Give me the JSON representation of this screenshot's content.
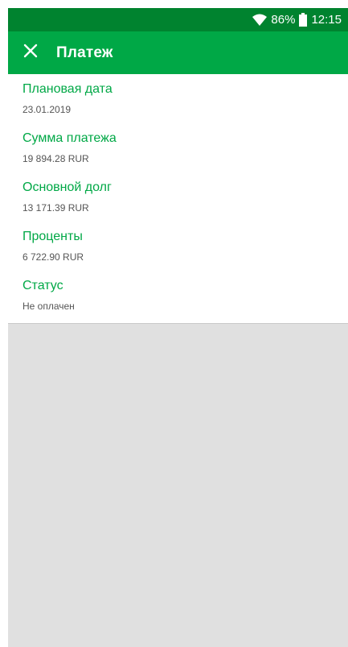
{
  "status_bar": {
    "battery": "86%",
    "time": "12:15",
    "icons": [
      "wifi-icon",
      "battery-icon"
    ]
  },
  "app_bar": {
    "title": "Платеж",
    "close_icon": "close-icon"
  },
  "details": [
    {
      "label": "Плановая дата",
      "value": "23.01.2019"
    },
    {
      "label": "Сумма платежа",
      "value": "19 894.28 RUR"
    },
    {
      "label": "Основной долг",
      "value": "13 171.39 RUR"
    },
    {
      "label": "Проценты",
      "value": "6 722.90 RUR"
    },
    {
      "label": "Статус",
      "value": "Не оплачен"
    }
  ],
  "colors": {
    "status_bar": "#00832f",
    "app_bar": "#00a846",
    "accent_text": "#00a846",
    "background": "#e0e0e0"
  }
}
